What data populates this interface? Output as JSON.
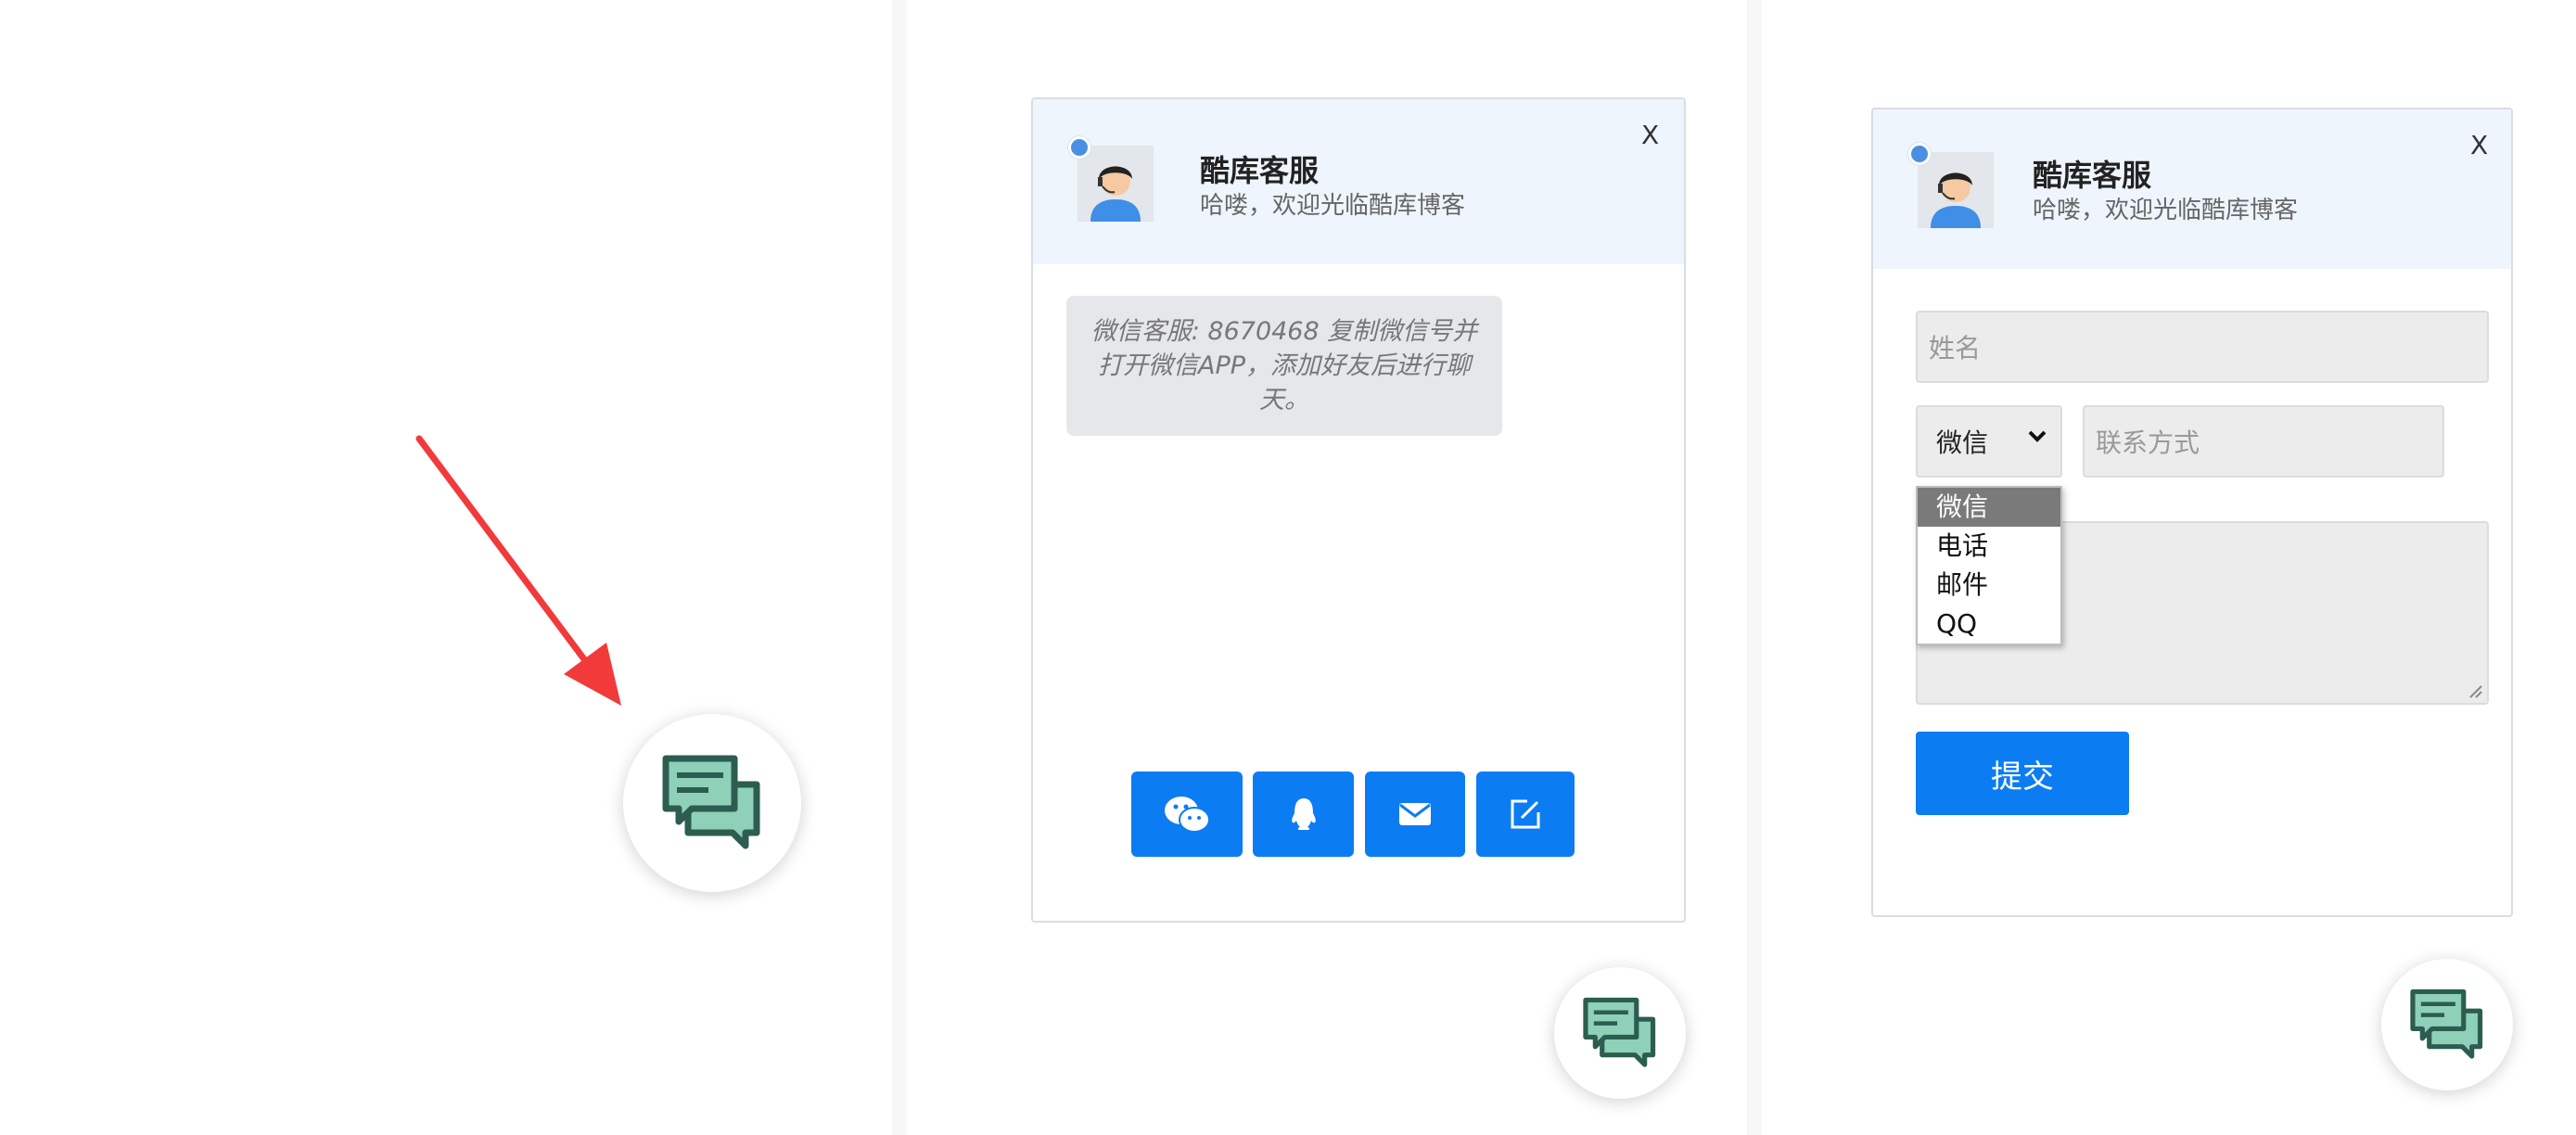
{
  "colors": {
    "accent": "#0c7cf2",
    "header_bg": "#eef5fd",
    "annotation_arrow": "#f23a3a",
    "chat_icon": "#3f7d6c"
  },
  "widget": {
    "name": "酷库客服",
    "greeting": "哈喽，欢迎光临酷库博客",
    "close_label": "X"
  },
  "chat": {
    "message_line1": "微信客服: 8670468 复制微信号并",
    "message_line2": "打开微信APP，添加好友后进行聊",
    "message_line3": "天。",
    "buttons": [
      {
        "icon": "wechat-icon"
      },
      {
        "icon": "qq-bell-icon"
      },
      {
        "icon": "mail-icon"
      },
      {
        "icon": "edit-icon"
      }
    ]
  },
  "form": {
    "name_placeholder": "姓名",
    "contact_type_value": "微信",
    "contact_placeholder": "联系方式",
    "contact_options": [
      "微信",
      "电话",
      "邮件",
      "QQ"
    ],
    "submit_label": "提交"
  }
}
